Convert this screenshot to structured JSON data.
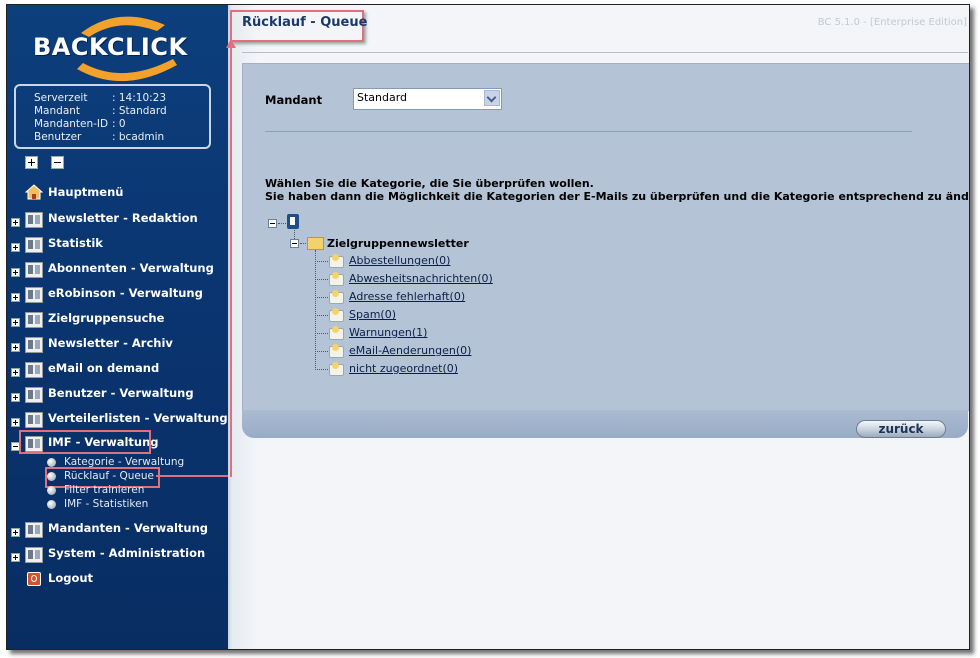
{
  "app": {
    "logo_text": "BACKCLICK",
    "version": "BC 5.1.0 - [Enterprise Edition]"
  },
  "info": {
    "rows": [
      {
        "key": "Serverzeit",
        "value": ": 14:10:23"
      },
      {
        "key": "Mandant",
        "value": ": Standard"
      },
      {
        "key": "Mandanten-ID",
        "value": ": 0"
      },
      {
        "key": "Benutzer",
        "value": ": bcadmin"
      }
    ]
  },
  "sidebar": {
    "items": [
      {
        "label": "Hauptmenü",
        "icon": "home-icon"
      },
      {
        "label": "Newsletter - Redaktion",
        "icon": "folder-icon"
      },
      {
        "label": "Statistik",
        "icon": "folder-icon"
      },
      {
        "label": "Abonnenten - Verwaltung",
        "icon": "folder-icon"
      },
      {
        "label": "eRobinson - Verwaltung",
        "icon": "folder-icon"
      },
      {
        "label": "Zielgruppensuche",
        "icon": "folder-icon"
      },
      {
        "label": "Newsletter - Archiv",
        "icon": "folder-icon"
      },
      {
        "label": "eMail on demand",
        "icon": "folder-icon"
      },
      {
        "label": "Benutzer - Verwaltung",
        "icon": "folder-icon"
      },
      {
        "label": "Verteilerlisten - Verwaltung",
        "icon": "folder-icon"
      },
      {
        "label": "IMF - Verwaltung",
        "icon": "folder-open-icon"
      },
      {
        "label": "Mandanten - Verwaltung",
        "icon": "folder-icon"
      },
      {
        "label": "System - Administration",
        "icon": "folder-icon"
      },
      {
        "label": "Logout",
        "icon": "logout-icon"
      }
    ],
    "imf_sub": [
      {
        "label": "Kategorie - Verwaltung"
      },
      {
        "label": "Rücklauf - Queue"
      },
      {
        "label": "Filter trainieren"
      },
      {
        "label": "IMF - Statistiken"
      }
    ]
  },
  "main": {
    "title": "Rücklauf - Queue",
    "mandant_label": "Mandant",
    "mandant_value": "Standard",
    "instruction_1": "Wählen Sie die Kategorie, die Sie überprüfen wollen.",
    "instruction_2": "Sie haben dann die Möglichkeit die Kategorien der E-Mails zu überprüfen und die Kategorie entsprechend zu ändern.",
    "tree": {
      "folder": "Zielgruppennewsletter",
      "leaves": [
        "Abbestellungen(0)",
        "Abwesheitsnachrichten(0)",
        "Adresse fehlerhaft(0)",
        "Spam(0)",
        "Warnungen(1)",
        "eMail-Aenderungen(0)",
        "nicht zugeordnet(0)"
      ]
    },
    "back_label": "zurück"
  },
  "colors": {
    "sidebar": "#0a3570",
    "panel": "#b4c4d6",
    "highlight": "#e0707e"
  }
}
